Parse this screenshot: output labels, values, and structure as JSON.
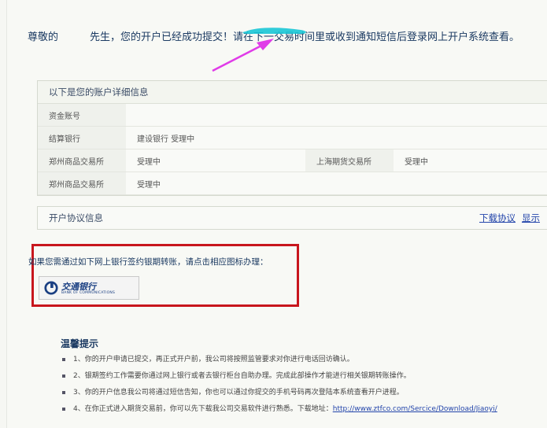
{
  "notice": {
    "greeting": "尊敬的",
    "salutation": "先生，您的开户已经成功提交！",
    "highlight": "请在下一交易时间里",
    "rest": "或收到通知短信后登录网上开户系统查看。"
  },
  "account_panel": {
    "title": "以下是您的账户详细信息",
    "rows": [
      {
        "label": "资金账号",
        "value": ""
      },
      {
        "label": "结算银行",
        "value": "建设银行 受理中"
      },
      {
        "label": "郑州商品交易所",
        "value": "受理中",
        "label2": "上海期货交易所",
        "value2": "受理中"
      },
      {
        "label": "郑州商品交易所",
        "value": "受理中"
      }
    ]
  },
  "protocol": {
    "title": "开户协议信息",
    "download_label": "下载协议",
    "show_label": "显示"
  },
  "bank": {
    "prompt": "如果您需通过如下网上银行签约银期转账，请点击相应图标办理：",
    "name_cn": "交通银行",
    "name_en": "BANK OF COMMUNICATIONS"
  },
  "tips": {
    "title": "温馨提示",
    "items": [
      "1、你的开户申请已提交，再正式开户前，我公司将按照监管要求对你进行电话回访确认。",
      "2、银期签约工作需要你通过网上银行或者去银行柜台自助办理。完成此部操作才能进行相关银期转账操作。",
      "3、你的开户信息我公司将通过短信告知，你也可以通过你提交的手机号码再次登陆本系统查看开户进程。",
      "4、在你正式进入期货交易前，你可以先下载我公司交易软件进行熟悉。下载地址："
    ],
    "download_url": "http://www.ztfco.com/Sercice/Download/Jiaoyi/"
  },
  "colors": {
    "annotation_red": "#c8161d",
    "highlight_cyan": "#19c6d6",
    "arrow_magenta": "#e03ce8"
  }
}
